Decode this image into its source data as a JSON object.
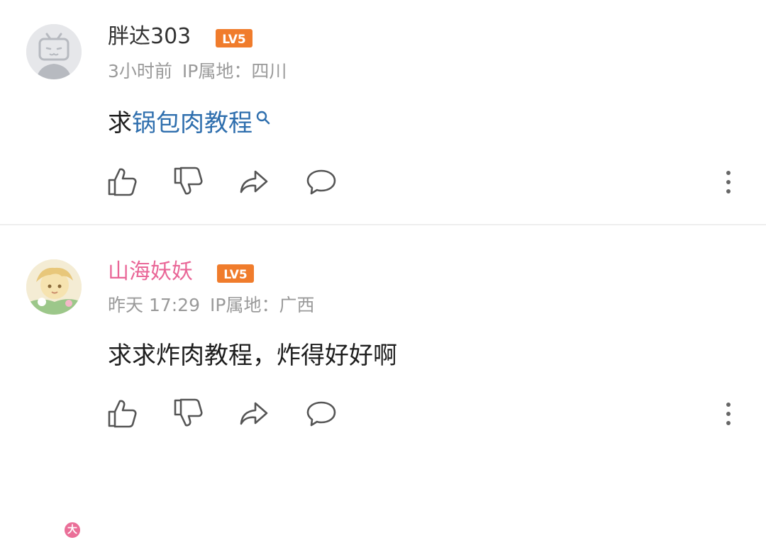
{
  "comments": [
    {
      "username": "胖达303",
      "level": "LV5",
      "time": "3小时前",
      "ip": "IP属地：四川",
      "text_prefix": "求",
      "text_link": "锅包肉教程",
      "username_color": "#333333",
      "avatar_icon": "tv-face-icon"
    },
    {
      "username": "山海妖妖",
      "level": "LV5",
      "time": "昨天 17:29",
      "ip": "IP属地：广西",
      "text": "求求炸肉教程，炸得好好啊",
      "username_color": "#e96697",
      "avatar_icon": "anime-avatar-icon",
      "avatar_badge": "大"
    }
  ],
  "actions": [
    "thumb-up-icon",
    "thumb-down-icon",
    "share-icon",
    "reply-icon",
    "more-icon"
  ],
  "colors": {
    "level_badge": "#f07c2c",
    "link": "#2f6fae",
    "meta": "#9a9a9a",
    "vip_name": "#e96697"
  }
}
